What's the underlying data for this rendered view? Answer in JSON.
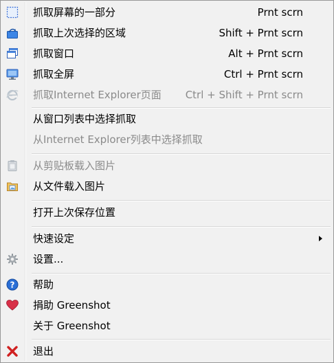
{
  "menu": {
    "capture_region": {
      "label": "抓取屏幕的一部分",
      "shortcut": "Prnt scrn"
    },
    "capture_last_region": {
      "label": "抓取上次选择的区域",
      "shortcut": "Shift + Prnt scrn"
    },
    "capture_window": {
      "label": "抓取窗口",
      "shortcut": "Alt + Prnt scrn"
    },
    "capture_fullscreen": {
      "label": "抓取全屏",
      "shortcut": "Ctrl + Prnt scrn"
    },
    "capture_ie": {
      "label": "抓取Internet Explorer页面",
      "shortcut": "Ctrl + Shift + Prnt scrn"
    },
    "capture_from_window_list": {
      "label": "从窗口列表中选择抓取"
    },
    "capture_from_ie_list": {
      "label": "从Internet Explorer列表中选择抓取"
    },
    "open_from_clipboard": {
      "label": "从剪贴板载入图片"
    },
    "open_from_file": {
      "label": "从文件载入图片"
    },
    "open_last_location": {
      "label": "打开上次保存位置"
    },
    "quick_settings": {
      "label": "快速设定"
    },
    "settings": {
      "label": "设置..."
    },
    "help": {
      "label": "帮助"
    },
    "donate": {
      "label": "捐助 Greenshot"
    },
    "about": {
      "label": "关于 Greenshot"
    },
    "exit": {
      "label": "退出"
    }
  },
  "icons": {
    "region": "region-select-icon",
    "last_region": "last-region-icon",
    "window": "window-icon",
    "fullscreen": "monitor-icon",
    "ie": "internet-explorer-icon",
    "clipboard": "clipboard-icon",
    "file": "folder-icon",
    "settings": "gear-icon",
    "help": "help-icon",
    "donate": "heart-icon",
    "exit": "close-icon"
  },
  "colors": {
    "menu_background": "#f1f1f1",
    "border": "#979797",
    "disabled_text": "#8a8a8a",
    "accent_blue": "#2a6fd6",
    "heart_red": "#d83048",
    "exit_red": "#d02020"
  }
}
